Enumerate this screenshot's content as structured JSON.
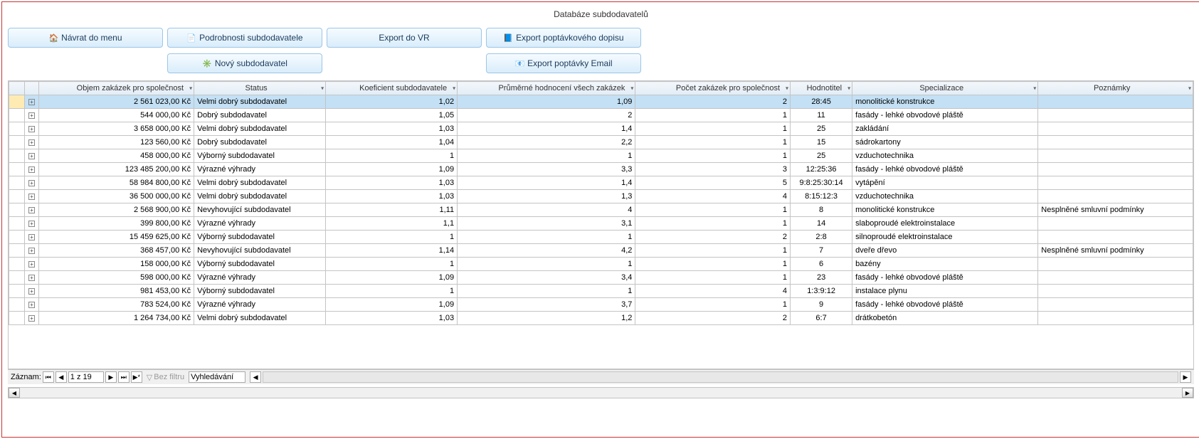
{
  "title": "Databáze subdodavatelů",
  "toolbar": {
    "back": "Návrat do menu",
    "details": "Podrobnosti subdodavatele",
    "export_vr": "Export do VR",
    "export_letter": "Export poptávkového dopisu",
    "new_sub": "Nový subdodavatel",
    "export_email": "Export poptávky Email"
  },
  "columns": [
    "Objem zakázek pro společnost",
    "Status",
    "Koeficient subdodavatele",
    "Průměrné hodnocení všech zakázek",
    "Počet zakázek pro společnost",
    "Hodnotitel",
    "Specializace",
    "Poznámky"
  ],
  "rows": [
    {
      "objem": "2 561 023,00 Kč",
      "status": "Velmi dobrý subdodavatel",
      "koef": "1,02",
      "prumer": "1,09",
      "pocet": "2",
      "hod": "28:45",
      "spec": "monolitické konstrukce",
      "pozn": ""
    },
    {
      "objem": "544 000,00 Kč",
      "status": "Dobrý subdodavatel",
      "koef": "1,05",
      "prumer": "2",
      "pocet": "1",
      "hod": "11",
      "spec": "fasády - lehké obvodové pláště",
      "pozn": ""
    },
    {
      "objem": "3 658 000,00 Kč",
      "status": "Velmi dobrý subdodavatel",
      "koef": "1,03",
      "prumer": "1,4",
      "pocet": "1",
      "hod": "25",
      "spec": "zakládání",
      "pozn": ""
    },
    {
      "objem": "123 560,00 Kč",
      "status": "Dobrý subdodavatel",
      "koef": "1,04",
      "prumer": "2,2",
      "pocet": "1",
      "hod": "15",
      "spec": "sádrokartony",
      "pozn": ""
    },
    {
      "objem": "458 000,00 Kč",
      "status": "Výborný subdodavatel",
      "koef": "1",
      "prumer": "1",
      "pocet": "1",
      "hod": "25",
      "spec": "vzduchotechnika",
      "pozn": ""
    },
    {
      "objem": "123 485 200,00 Kč",
      "status": "Výrazné výhrady",
      "koef": "1,09",
      "prumer": "3,3",
      "pocet": "3",
      "hod": "12:25:36",
      "spec": "fasády - lehké obvodové pláště",
      "pozn": ""
    },
    {
      "objem": "58 984 800,00 Kč",
      "status": "Velmi dobrý subdodavatel",
      "koef": "1,03",
      "prumer": "1,4",
      "pocet": "5",
      "hod": "9:8:25:30:14",
      "spec": "vytápění",
      "pozn": ""
    },
    {
      "objem": "36 500 000,00 Kč",
      "status": "Velmi dobrý subdodavatel",
      "koef": "1,03",
      "prumer": "1,3",
      "pocet": "4",
      "hod": "8:15:12:3",
      "spec": "vzduchotechnika",
      "pozn": ""
    },
    {
      "objem": "2 568 900,00 Kč",
      "status": "Nevyhovující subdodavatel",
      "koef": "1,11",
      "prumer": "4",
      "pocet": "1",
      "hod": "8",
      "spec": "monolitické konstrukce",
      "pozn": "Nesplněné smluvní podmínky"
    },
    {
      "objem": "399 800,00 Kč",
      "status": "Výrazné výhrady",
      "koef": "1,1",
      "prumer": "3,1",
      "pocet": "1",
      "hod": "14",
      "spec": "slaboproudé elektroinstalace",
      "pozn": ""
    },
    {
      "objem": "15 459 625,00 Kč",
      "status": "Výborný subdodavatel",
      "koef": "1",
      "prumer": "1",
      "pocet": "2",
      "hod": "2:8",
      "spec": "silnoproudé elektroinstalace",
      "pozn": ""
    },
    {
      "objem": "368 457,00 Kč",
      "status": "Nevyhovující subdodavatel",
      "koef": "1,14",
      "prumer": "4,2",
      "pocet": "1",
      "hod": "7",
      "spec": "dveře dřevo",
      "pozn": "Nesplněné smluvní podmínky"
    },
    {
      "objem": "158 000,00 Kč",
      "status": "Výborný subdodavatel",
      "koef": "1",
      "prumer": "1",
      "pocet": "1",
      "hod": "6",
      "spec": "bazény",
      "pozn": ""
    },
    {
      "objem": "598 000,00 Kč",
      "status": "Výrazné výhrady",
      "koef": "1,09",
      "prumer": "3,4",
      "pocet": "1",
      "hod": "23",
      "spec": "fasády - lehké obvodové pláště",
      "pozn": ""
    },
    {
      "objem": "981 453,00 Kč",
      "status": "Výborný subdodavatel",
      "koef": "1",
      "prumer": "1",
      "pocet": "4",
      "hod": "1:3:9:12",
      "spec": "instalace plynu",
      "pozn": ""
    },
    {
      "objem": "783 524,00 Kč",
      "status": "Výrazné výhrady",
      "koef": "1,09",
      "prumer": "3,7",
      "pocet": "1",
      "hod": "9",
      "spec": "fasády - lehké obvodové pláště",
      "pozn": ""
    },
    {
      "objem": "1 264 734,00 Kč",
      "status": "Velmi dobrý subdodavatel",
      "koef": "1,03",
      "prumer": "1,2",
      "pocet": "2",
      "hod": "6:7",
      "spec": "drátkobetón",
      "pozn": ""
    }
  ],
  "recnav": {
    "label": "Záznam:",
    "pos": "1 z 19",
    "filter": "Bez filtru",
    "search": "Vyhledávání"
  }
}
